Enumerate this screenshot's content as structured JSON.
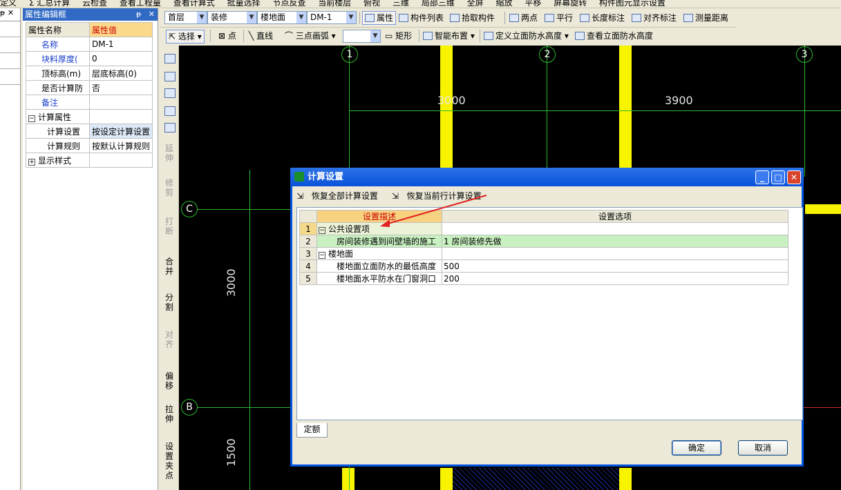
{
  "cut_toolbar": [
    "定义",
    "Σ 汇总计算",
    "云检查",
    "查看工程量",
    "查看计算式",
    "批量选择",
    "节点反查",
    "当前楼层",
    "俯视",
    "三维",
    "局部三维",
    "全屏",
    "缩放",
    "平移",
    "屏幕旋转",
    "构件图元显示设置"
  ],
  "left_panel": {
    "header": "ᵽ ✕"
  },
  "property_panel": {
    "title": "属性编辑框",
    "pin": "ᵽ",
    "close": "✕",
    "col_name": "属性名称",
    "col_value": "属性值",
    "rows": [
      {
        "name": "名称",
        "value": "DM-1"
      },
      {
        "name": "块料厚度(",
        "value": "0"
      },
      {
        "name": "顶标高(m)",
        "value": "层底标高(0)"
      },
      {
        "name": "是否计算防",
        "value": "否"
      },
      {
        "name": "备注",
        "value": ""
      },
      {
        "name": "计算属性",
        "value": "",
        "expander": "−"
      },
      {
        "name": "计算设置",
        "value": "按设定计算设置"
      },
      {
        "name": "计算规则",
        "value": "按默认计算规则"
      },
      {
        "name": "显示样式",
        "value": "",
        "expander": "+"
      }
    ]
  },
  "toolbar1": {
    "floor": "首层",
    "category": "装修",
    "component_type": "楼地面",
    "component": "DM-1",
    "attr_btn": "属性",
    "list_btn": "构件列表",
    "pick_btn": "拾取构件",
    "two_points": "两点",
    "parallel": "平行",
    "length_dim": "长度标注",
    "align_dim": "对齐标注",
    "measure": "测量距离"
  },
  "toolbar2": {
    "select": "选择",
    "point": "点",
    "line": "直线",
    "arc": "三点画弧",
    "combo_blank": "",
    "rect": "矩形",
    "smart": "智能布置",
    "define_height": "定义立面防水高度",
    "view_height": "查看立面防水高度"
  },
  "vertical_toolbar": [
    "延伸",
    "修剪",
    "打断",
    "合并",
    "分割",
    "对齐",
    "偏移",
    "拉伸",
    "设置夹点"
  ],
  "canvas": {
    "axes_top": [
      "1",
      "2",
      "3"
    ],
    "axes_left": [
      "C",
      "B"
    ],
    "dim_3000_top": "3000",
    "dim_3900": "3900",
    "dim_3000_left": "3000",
    "dim_1500": "1500"
  },
  "dialog": {
    "title": "计算设置",
    "restore_all": "恢复全部计算设置",
    "restore_current": "恢复当前行计算设置",
    "col_desc": "设置描述",
    "col_opt": "设置选项",
    "rows": [
      {
        "num": "1",
        "desc": "公共设置项",
        "opt": "",
        "expander": "−"
      },
      {
        "num": "2",
        "desc": "房间装修遇到间壁墙的施工",
        "opt": "1 房间装修先做"
      },
      {
        "num": "3",
        "desc": "楼地面",
        "opt": "",
        "expander": "−"
      },
      {
        "num": "4",
        "desc": "楼地面立面防水的最低高度",
        "opt": "500"
      },
      {
        "num": "5",
        "desc": "楼地面水平防水在门窗洞口",
        "opt": "200"
      }
    ],
    "tab": "定额",
    "ok": "确定",
    "cancel": "取消"
  },
  "colors": {
    "selection_blue": "#316ac5",
    "grid_green": "#2fbb2f",
    "wall_yellow": "#f8f400",
    "annotation_red": "#e02020"
  }
}
